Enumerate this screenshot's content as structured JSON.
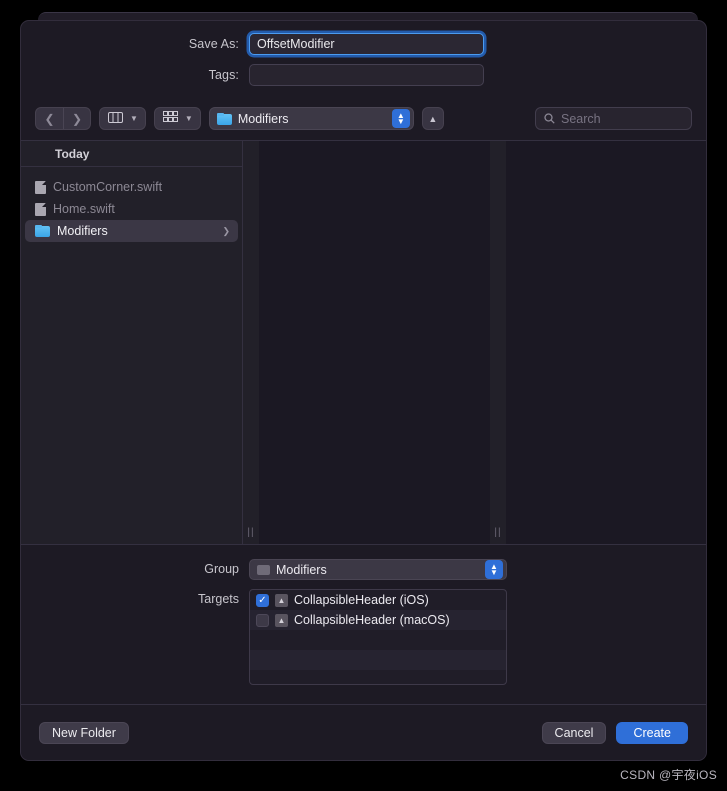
{
  "dialog": {
    "save_as_label": "Save As:",
    "save_as_value": "OffsetModifier",
    "tags_label": "Tags:",
    "tags_placeholder": ""
  },
  "toolbar": {
    "back_icon": "chevron-left-icon",
    "forward_icon": "chevron-right-icon",
    "view_column_icon": "column-view-icon",
    "view_group_icon": "gallery-view-icon",
    "path_label": "Modifiers",
    "up_icon": "chevron-up-icon",
    "search_placeholder": "Search"
  },
  "browser": {
    "section_header": "Today",
    "items": [
      {
        "name": "CustomCorner.swift",
        "icon": "document-icon",
        "selected": false,
        "has_disclosure": false
      },
      {
        "name": "Home.swift",
        "icon": "document-icon",
        "selected": false,
        "has_disclosure": false
      },
      {
        "name": "Modifiers",
        "icon": "folder-icon",
        "selected": true,
        "has_disclosure": true
      }
    ]
  },
  "options": {
    "group_label": "Group",
    "group_value": "Modifiers",
    "targets_label": "Targets",
    "targets": [
      {
        "name": "CollapsibleHeader (iOS)",
        "checked": true
      },
      {
        "name": "CollapsibleHeader (macOS)",
        "checked": false
      }
    ]
  },
  "footer": {
    "new_folder_label": "New Folder",
    "cancel_label": "Cancel",
    "create_label": "Create"
  },
  "watermark": "CSDN @宇夜iOS",
  "colors": {
    "accent": "#2f6fd8",
    "sheet_bg": "#1d1a24",
    "selected_row": "#3b3745"
  }
}
